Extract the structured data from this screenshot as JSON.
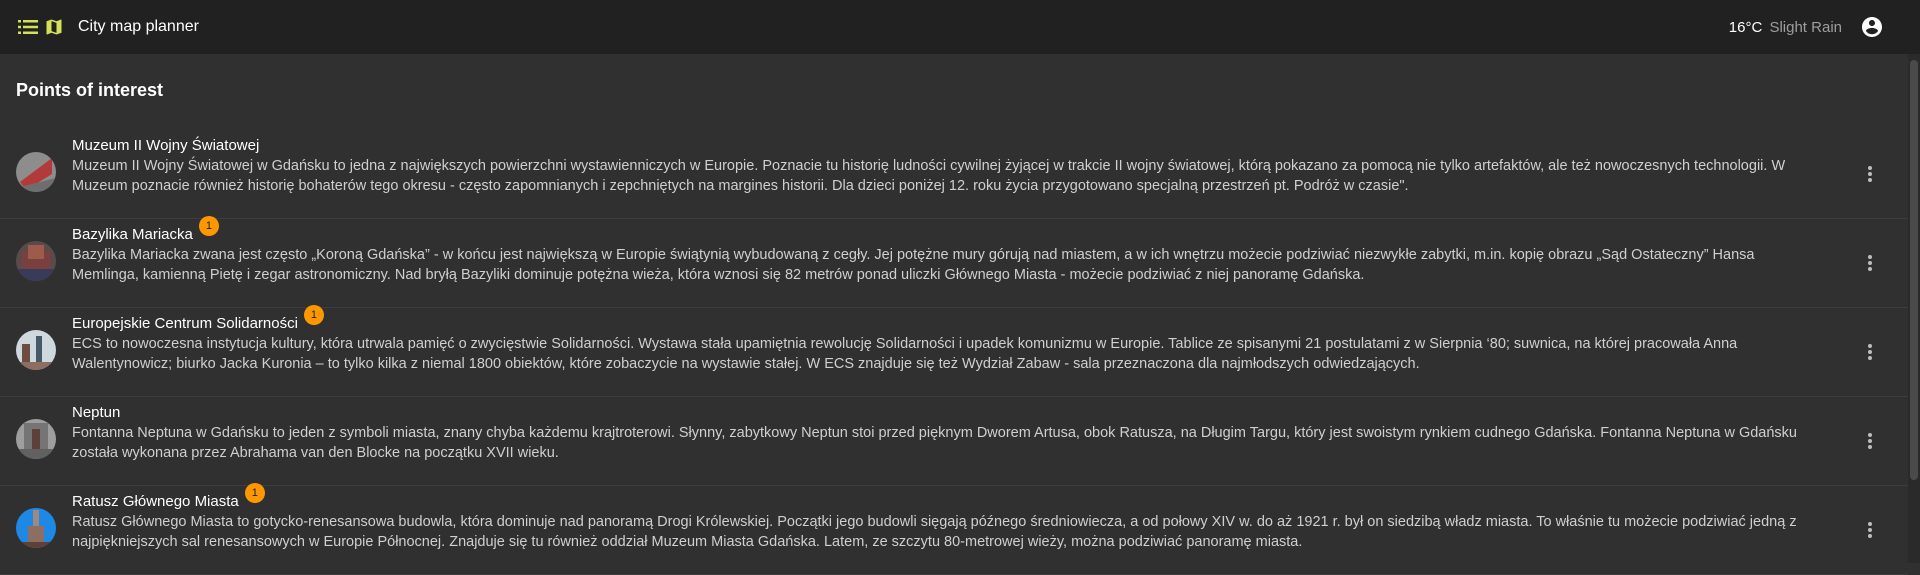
{
  "header": {
    "title": "City map planner",
    "weather_temp": "16°C",
    "weather_desc": "Slight Rain",
    "icons": [
      "menu-list-icon",
      "map-icon",
      "account-circle-icon"
    ]
  },
  "section_title": "Points of interest",
  "colors": {
    "badge": "#ff9800",
    "background": "#303030",
    "topbar": "#212121"
  },
  "items": [
    {
      "title": "Muzeum II Wojny Światowej",
      "badge": "",
      "description": " Muzeum II Wojny Światowej w Gdańsku to jedna z największych powierzchni wystawienniczych w Europie. Poznacie tu historię ludności cywilnej żyjącej w trakcie II wojny światowej, którą pokazano za pomocą nie tylko artefaktów, ale też nowoczesnych technologii. W Muzeum poznacie również historię bohaterów tego okresu - często zapomnianych i zepchniętych na margines historii. Dla dzieci poniżej 12. roku życia przygotowano specjalną przestrzeń pt. Podróż w czasie\"."
    },
    {
      "title": "Bazylika Mariacka",
      "badge": "1",
      "description": " Bazylika Mariacka zwana jest często „Koroną Gdańska” - w końcu jest największą w Europie świątynią wybudowaną z cegły. Jej potężne mury górują nad miastem, a w ich wnętrzu możecie podziwiać niezwykłe zabytki, m.in. kopię obrazu „Sąd Ostateczny” Hansa Memlinga, kamienną Pietę i zegar astronomiczny. Nad bryłą Bazyliki dominuje potężna wieża, która wznosi się 82 metrów ponad uliczki Głównego Miasta - możecie podziwiać z niej panoramę Gdańska."
    },
    {
      "title": "Europejskie Centrum Solidarności",
      "badge": "1",
      "description": " ECS to nowoczesna instytucja kultury, która utrwala pamięć o zwycięstwie Solidarności. Wystawa stała upamiętnia rewolucję Solidarności i upadek komunizmu w Europie. Tablice ze spisanymi 21 postulatami z w Sierpnia ‘80; suwnica, na której pracowała Anna Walentynowicz; biurko Jacka Kuronia – to tylko kilka z niemal 1800 obiektów, które zobaczycie na wystawie stałej. W ECS znajduje się też Wydział Zabaw - sala przeznaczona dla najmłodszych odwiedzających."
    },
    {
      "title": "Neptun",
      "badge": "",
      "description": " Fontanna Neptuna w Gdańsku to jeden z symboli miasta, znany chyba każdemu krajtroterowi. Słynny, zabytkowy Neptun stoi przed pięknym Dworem Artusa, obok Ratusza, na Długim Targu, który jest swoistym rynkiem cudnego Gdańska. Fontanna Neptuna w Gdańsku została wykonana przez Abrahama van den Blocke na początku XVII wieku."
    },
    {
      "title": "Ratusz Głównego Miasta",
      "badge": "1",
      "description": " Ratusz Głównego Miasta to gotycko-renesansowa budowla, która dominuje nad panoramą Drogi Królewskiej. Początki jego budowli sięgają późnego średniowiecza, a od połowy XIV w. do aż 1921 r. był on siedzibą władz miasta. To właśnie tu możecie podziwiać jedną z najpiękniejszych sal renesansowych w Europie Północnej. Znajduje się tu również oddział Muzeum Miasta Gdańska. Latem, ze szczytu 80-metrowej wieży, można podziwiać panoramę miasta."
    }
  ]
}
